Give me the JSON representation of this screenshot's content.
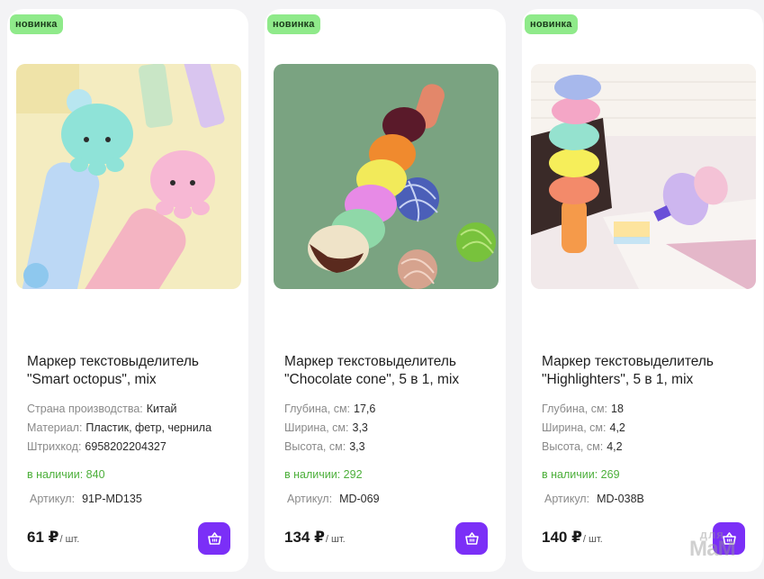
{
  "products": [
    {
      "badge": "новинка",
      "title": "Маркер текстовыделитель \"Smart octopus\", mix",
      "specs": [
        {
          "key": "Страна производства:",
          "value": "Китай"
        },
        {
          "key": "Материал:",
          "value": "Пластик, фетр, чернила"
        },
        {
          "key": "Штрихкод:",
          "value": "6958202204327"
        }
      ],
      "stock": "в наличии: 840",
      "article_label": "Артикул:",
      "article_value": "91P-MD135",
      "price": "61 ₽",
      "unit": "/ шт.",
      "cart_icon": "basket-icon"
    },
    {
      "badge": "новинка",
      "title": "Маркер текстовыделитель \"Chocolate cone\", 5 в 1, mix",
      "specs": [
        {
          "key": "Глубина, см:",
          "value": "17,6"
        },
        {
          "key": "Ширина, см:",
          "value": "3,3"
        },
        {
          "key": "Высота, см:",
          "value": "3,3"
        }
      ],
      "stock": "в наличии: 292",
      "article_label": "Артикул:",
      "article_value": "MD-069",
      "price": "134 ₽",
      "unit": "/ шт.",
      "cart_icon": "basket-icon"
    },
    {
      "badge": "новинка",
      "title": "Маркер текстовыделитель \"Highlighters\", 5 в 1, mix",
      "specs": [
        {
          "key": "Глубина, см:",
          "value": "18"
        },
        {
          "key": "Ширина, см:",
          "value": "4,2"
        },
        {
          "key": "Высота, см:",
          "value": "4,2"
        }
      ],
      "stock": "в наличии: 269",
      "article_label": "Артикул:",
      "article_value": "MD-038B",
      "price": "140 ₽",
      "unit": "/ шт.",
      "cart_icon": "basket-icon"
    }
  ],
  "watermark": {
    "line1": "для",
    "line2": "МаМ"
  },
  "colors": {
    "badge_bg": "#8fea8a",
    "stock_green": "#4caf3a",
    "cart_purple": "#7b2ff7",
    "page_bg": "#f3f3f5"
  }
}
